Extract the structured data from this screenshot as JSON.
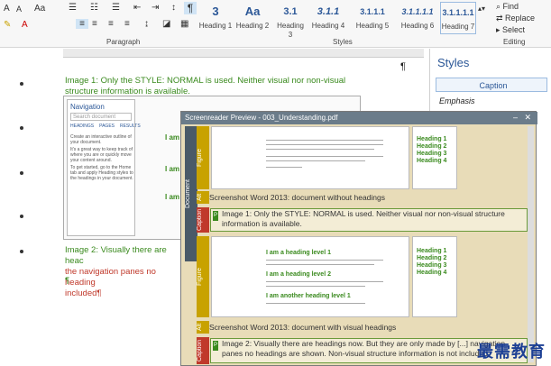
{
  "ribbon": {
    "font_size_up": "A",
    "font_size_down": "A",
    "change_case": "Aa",
    "paragraph_group_label": "Paragraph",
    "styles_group_label": "Styles",
    "editing_group_label": "Editing",
    "find_label": "Find",
    "replace_label": "Replace",
    "select_label": "Select",
    "pilcrow": "¶",
    "styles": [
      {
        "sample": "3",
        "name": "Heading 1"
      },
      {
        "sample": "Aa",
        "name": "Heading 2"
      },
      {
        "sample": "3.1",
        "name": "Heading 3"
      },
      {
        "sample": "3.1.1",
        "name": "Heading 4"
      },
      {
        "sample": "3.1.1.1",
        "name": "Heading 5"
      },
      {
        "sample": "3.1.1.1.1",
        "name": "Heading 6"
      },
      {
        "sample": "3.1.1.1.1",
        "name": "Heading 7"
      }
    ]
  },
  "document": {
    "para1": "Image 1: Only the STYLE: NORMAL is used. Neither visual nor non-visual structure information is available.",
    "para2_line1": "Image 2: Visually there are heac",
    "para2_line2": "the navigation panes no heading",
    "para2_line3": "included",
    "pilcrow": "¶",
    "bold_snippets": [
      "I am",
      "I am",
      "I am"
    ]
  },
  "navigation": {
    "title": "Navigation",
    "search_placeholder": "Search document",
    "tabs": [
      "HEADINGS",
      "PAGES",
      "RESULTS"
    ],
    "body1": "Create an interactive outline of your document.",
    "body2": "It's a great way to keep track of where you are or quickly move your content around.",
    "body3": "To get started, go to the Home tab and apply Heading styles to the headings in your document."
  },
  "styles_pane": {
    "title": "Styles",
    "items": [
      "Caption",
      "Emphasis"
    ]
  },
  "preview": {
    "title": "Screenreader Preview - 003_Understanding.pdf",
    "tabs": [
      {
        "label": "Document",
        "color": "#4a5a68"
      },
      {
        "label": "Figure",
        "color": "#c8a200"
      },
      {
        "label": "Alt",
        "color": "#c8a200"
      },
      {
        "label": "Caption",
        "color": "#c0392b"
      },
      {
        "label": "Figure",
        "color": "#c8a200"
      },
      {
        "label": "Alt",
        "color": "#c8a200"
      },
      {
        "label": "Caption",
        "color": "#c0392b"
      }
    ],
    "alt1": "Screenshot Word 2013: document without headings",
    "caption1_marker": "P",
    "caption1": "Image 1: Only the STYLE: NORMAL is used. Neither visual nor non-visual structure information is available.",
    "alt2": "Screenshot Word 2013: document with visual headings",
    "caption2_marker": "P",
    "caption2": "Image 2: Visually there are headings now. But they are only made by [...] navigation panes no headings are shown. Non-visual structure information is not included.",
    "mini_headings": [
      "I am a heading level 1",
      "I am a heading level 2",
      "I am another heading level 1"
    ],
    "mini_sidebar_items": [
      "Heading 1",
      "Heading 2",
      "Heading 3",
      "Heading 4"
    ]
  },
  "watermark": "最需教育"
}
